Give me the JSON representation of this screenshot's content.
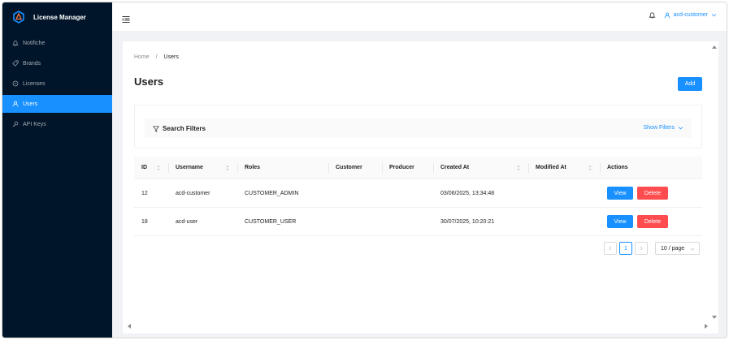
{
  "app": {
    "title": "License Manager",
    "accent": "#1890ff",
    "sidebar_bg": "#001529",
    "danger": "#ff4d4f"
  },
  "sidebar": {
    "items": [
      {
        "label": "Notifiche",
        "icon": "bell-icon",
        "active": false
      },
      {
        "label": "Brands",
        "icon": "tag-icon",
        "active": false
      },
      {
        "label": "Licenses",
        "icon": "key-icon",
        "active": false
      },
      {
        "label": "Users",
        "icon": "user-icon",
        "active": true
      },
      {
        "label": "API Keys",
        "icon": "api-key-icon",
        "active": false
      }
    ]
  },
  "header": {
    "user": "acd-customer"
  },
  "breadcrumb": {
    "home": "Home",
    "separator": "/",
    "current": "Users"
  },
  "page": {
    "title": "Users",
    "add_label": "Add"
  },
  "filters": {
    "title": "Search Filters",
    "toggle_label": "Show Filters"
  },
  "table": {
    "columns": [
      "ID",
      "Username",
      "Roles",
      "Customer",
      "Producer",
      "Created At",
      "Modified At",
      "Actions"
    ],
    "rows": [
      {
        "id": "12",
        "username": "acd-customer",
        "roles": "CUSTOMER_ADMIN",
        "customer": "",
        "producer": "",
        "created_at": "03/06/2025, 13:34:48",
        "modified_at": ""
      },
      {
        "id": "18",
        "username": "acd-user",
        "roles": "CUSTOMER_USER",
        "customer": "",
        "producer": "",
        "created_at": "30/07/2025, 10:20:21",
        "modified_at": ""
      }
    ],
    "view_label": "View",
    "delete_label": "Delete"
  },
  "pagination": {
    "current_page": "1",
    "page_size": "10 / page"
  }
}
